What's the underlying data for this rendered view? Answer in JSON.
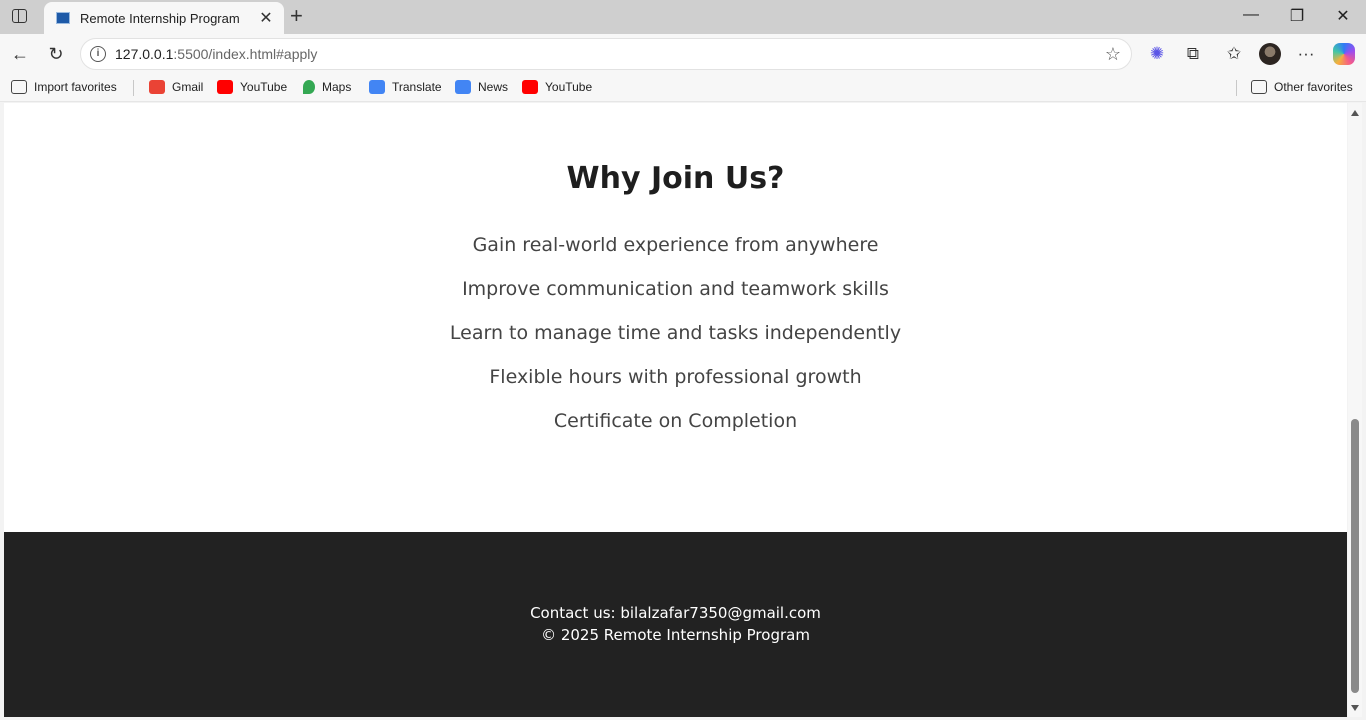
{
  "browser": {
    "tab_title": "Remote Internship Program",
    "tab_close": "✕",
    "new_tab": "+",
    "url_host": "127.0.0.1",
    "url_path": ":5500/index.html#apply",
    "window_controls": {
      "minimize": "—",
      "restore": "❐",
      "close": "✕"
    },
    "nav": {
      "back": "←",
      "reload": "↻"
    },
    "toolbar_icons": {
      "star": "☆",
      "extensions": "⧉",
      "favorites": "✩",
      "more": "···"
    }
  },
  "bookmarks": {
    "import": "Import favorites",
    "items": [
      {
        "label": "Gmail",
        "icon": "gmail-icon",
        "color": "#ea4335"
      },
      {
        "label": "YouTube",
        "icon": "youtube-icon",
        "color": "#ff0000"
      },
      {
        "label": "Maps",
        "icon": "maps-icon",
        "color": "#34a853"
      },
      {
        "label": "Translate",
        "icon": "translate-icon",
        "color": "#4285f4"
      },
      {
        "label": "News",
        "icon": "news-icon",
        "color": "#4285f4"
      },
      {
        "label": "YouTube",
        "icon": "youtube-icon",
        "color": "#ff0000"
      }
    ],
    "other": "Other favorites"
  },
  "why_section": {
    "heading": "Why Join Us?",
    "points": [
      "Gain real-world experience from anywhere",
      "Improve communication and teamwork skills",
      "Learn to manage time and tasks independently",
      "Flexible hours with professional growth",
      "Certificate on Completion"
    ]
  },
  "footer": {
    "contact": "Contact us: bilalzafar7350@gmail.com",
    "copyright": "© 2025 Remote Internship Program",
    "background": "#222222"
  }
}
